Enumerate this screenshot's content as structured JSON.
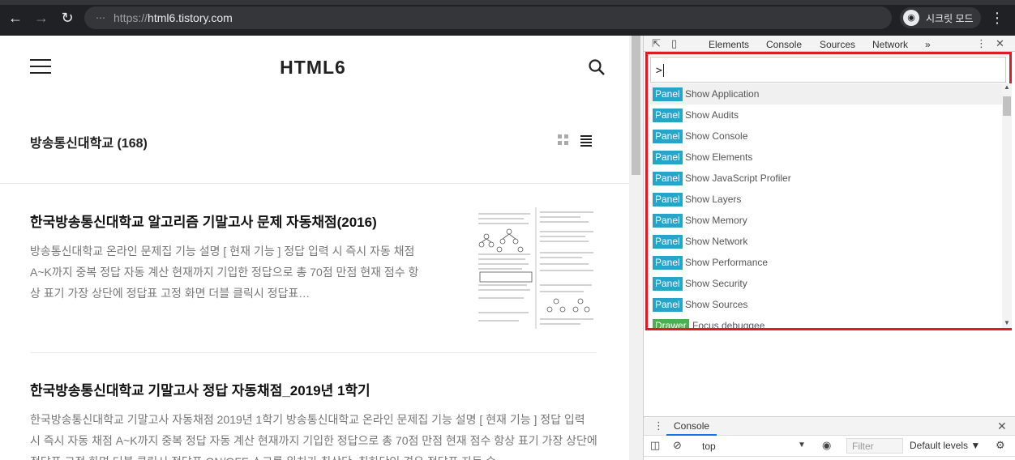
{
  "browser": {
    "url_scheme": "https://",
    "url_host": "html6.tistory.com",
    "incognito_label": "시크릿 모드",
    "back_icon": "arrow-left",
    "forward_icon": "arrow-right",
    "reload_icon": "reload",
    "menu_icon": "vertical-dots"
  },
  "page": {
    "site_title": "HTML6",
    "category_title": "방송통신대학교 (168)",
    "posts": [
      {
        "title": "한국방송통신대학교 알고리즘 기말고사 문제 자동채점(2016)",
        "excerpt": "방송통신대학교 온라인 문제집 기능 설명 [ 현재 기능 ] 정답 입력 시 즉시 자동 채점 A~K까지 중복 정답 자동 계산 현재까지 기입한 정답으로 총 70점 만점 현재 점수 항상 표기 가장 상단에 정답표 고정 화면 더블 클릭시 정답표…"
      },
      {
        "title": "한국방송통신대학교 기말고사 정답 자동채점_2019년 1학기",
        "excerpt": "한국방송통신대학교 기말고사 자동채점 2019년 1학기 방송통신대학교 온라인 문제집 기능 설명 [ 현재 기능 ] 정답 입력 시 즉시 자동 채점 A~K까지 중복 정답 자동 계산 현재까지 기입한 정답으로 총 70점 만점 현재 점수 항상 표기 가장 상단에 정답표 고정 화면 더블 클릭시 정답표 ON/OFF 스크롤 위치가 최상단, 최하단인 경우 정답표 자동 숨…"
      }
    ]
  },
  "devtools": {
    "tabs": [
      "Elements",
      "Console",
      "Sources",
      "Network"
    ],
    "more_tabs": "»",
    "command_input": ">",
    "commands": [
      {
        "badge": "Panel",
        "label": "Show Application"
      },
      {
        "badge": "Panel",
        "label": "Show Audits"
      },
      {
        "badge": "Panel",
        "label": "Show Console"
      },
      {
        "badge": "Panel",
        "label": "Show Elements"
      },
      {
        "badge": "Panel",
        "label": "Show JavaScript Profiler"
      },
      {
        "badge": "Panel",
        "label": "Show Layers"
      },
      {
        "badge": "Panel",
        "label": "Show Memory"
      },
      {
        "badge": "Panel",
        "label": "Show Network"
      },
      {
        "badge": "Panel",
        "label": "Show Performance"
      },
      {
        "badge": "Panel",
        "label": "Show Security"
      },
      {
        "badge": "Panel",
        "label": "Show Sources"
      },
      {
        "badge": "Drawer",
        "label": "Focus debuggee"
      }
    ],
    "drawer_tab": "Console",
    "context": "top",
    "filter_placeholder": "Filter",
    "levels": "Default levels ▼",
    "accent": "#e01b24",
    "panel_badge_color": "#26a5c9",
    "drawer_badge_color": "#4caf50"
  }
}
